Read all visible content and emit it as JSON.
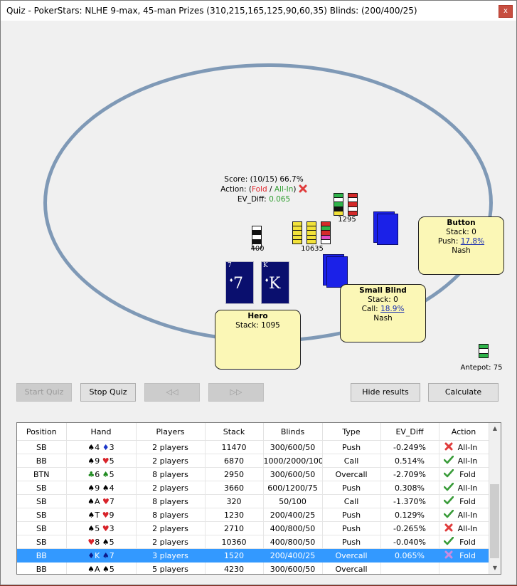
{
  "window": {
    "title": "Quiz - PokerStars: NLHE 9-max, 45-man Prizes (310,215,165,125,90,60,35) Blinds: (200/400/25)",
    "close_label": "x"
  },
  "quiz_info": {
    "score": "Score: (10/15) 66.7%",
    "action_prefix": "Action: (",
    "action_fold": "Fold",
    "action_sep": " / ",
    "action_allin": "All-In",
    "action_suffix": ")",
    "ev_prefix": "EV_Diff: ",
    "ev_value": "0.065"
  },
  "players": {
    "button": {
      "name": "Button",
      "stack": "Stack: 0",
      "push_prefix": "Push: ",
      "push_pct": "17.8%",
      "mode": "Nash"
    },
    "small_blind": {
      "name": "Small Blind",
      "stack": "Stack: 0",
      "call_prefix": "Call: ",
      "call_pct": "18.9%",
      "mode": "Nash"
    },
    "hero": {
      "name": "Hero",
      "stack": "Stack: 1095"
    }
  },
  "hero_cards": [
    {
      "rank": "7",
      "suit": "♦"
    },
    {
      "rank": "K",
      "suit": "♦"
    }
  ],
  "chips": {
    "hero_bet": "400",
    "pot": "10635",
    "sb_bet": "1295",
    "antepot": "Antepot: 75"
  },
  "colors": {
    "chip_white": "#ffffff",
    "chip_black": "#111111",
    "chip_yellow": "#f2e23a",
    "chip_green": "#2fb34a",
    "chip_red": "#d42a2a",
    "chip_pink": "#e04cc2"
  },
  "buttons": {
    "start_quiz": "Start Quiz",
    "stop_quiz": "Stop Quiz",
    "prev": "◁◁",
    "next": "▷▷",
    "hide_results": "Hide results",
    "calculate": "Calculate"
  },
  "results": {
    "columns": [
      "Position",
      "Hand",
      "Players",
      "Stack",
      "Blinds",
      "Type",
      "EV_Diff",
      "Action"
    ],
    "rows": [
      {
        "position": "SB",
        "hand": [
          [
            "♠",
            "4",
            "b"
          ],
          [
            "♦",
            "3",
            "u"
          ]
        ],
        "players": "2 players",
        "stack": "11470",
        "blinds": "300/600/50",
        "type": "Push",
        "ev": "-0.249%",
        "icon": "wrong",
        "action": "All-In"
      },
      {
        "position": "BB",
        "hand": [
          [
            "♠",
            "9",
            "b"
          ],
          [
            "♥",
            "5",
            "r"
          ]
        ],
        "players": "2 players",
        "stack": "6870",
        "blinds": "1000/2000/100",
        "type": "Call",
        "ev": "0.514%",
        "icon": "right",
        "action": "All-In"
      },
      {
        "position": "BTN",
        "hand": [
          [
            "♣",
            "6",
            "g"
          ],
          [
            "♠",
            "5",
            "g"
          ]
        ],
        "players": "8 players",
        "stack": "2950",
        "blinds": "300/600/50",
        "type": "Overcall",
        "ev": "-2.709%",
        "icon": "right",
        "action": "Fold"
      },
      {
        "position": "SB",
        "hand": [
          [
            "♠",
            "9",
            "b"
          ],
          [
            "♠",
            "4",
            "b"
          ]
        ],
        "players": "2 players",
        "stack": "3660",
        "blinds": "600/1200/75",
        "type": "Push",
        "ev": "0.308%",
        "icon": "right",
        "action": "All-In"
      },
      {
        "position": "SB",
        "hand": [
          [
            "♠",
            "A",
            "b"
          ],
          [
            "♥",
            "7",
            "r"
          ]
        ],
        "players": "8 players",
        "stack": "320",
        "blinds": "50/100",
        "type": "Call",
        "ev": "-1.370%",
        "icon": "right",
        "action": "Fold"
      },
      {
        "position": "SB",
        "hand": [
          [
            "♠",
            "T",
            "b"
          ],
          [
            "♥",
            "9",
            "r"
          ]
        ],
        "players": "8 players",
        "stack": "1230",
        "blinds": "200/400/25",
        "type": "Push",
        "ev": "0.129%",
        "icon": "right",
        "action": "All-In"
      },
      {
        "position": "SB",
        "hand": [
          [
            "♠",
            "5",
            "b"
          ],
          [
            "♥",
            "3",
            "r"
          ]
        ],
        "players": "2 players",
        "stack": "2710",
        "blinds": "400/800/50",
        "type": "Push",
        "ev": "-0.265%",
        "icon": "wrong",
        "action": "All-In"
      },
      {
        "position": "SB",
        "hand": [
          [
            "♥",
            "8",
            "r"
          ],
          [
            "♠",
            "5",
            "b"
          ]
        ],
        "players": "2 players",
        "stack": "10360",
        "blinds": "400/800/50",
        "type": "Push",
        "ev": "-0.040%",
        "icon": "right",
        "action": "Fold"
      },
      {
        "position": "BB",
        "hand": [
          [
            "♦",
            "K",
            "u"
          ],
          [
            "♠",
            "7",
            "b"
          ]
        ],
        "players": "3 players",
        "stack": "1520",
        "blinds": "200/400/25",
        "type": "Overcall",
        "ev": "0.065%",
        "icon": "wrong-purple",
        "action": "Fold",
        "selected": true
      },
      {
        "position": "BB",
        "hand": [
          [
            "♠",
            "A",
            "b"
          ],
          [
            "♠",
            "5",
            "b"
          ]
        ],
        "players": "5 players",
        "stack": "4230",
        "blinds": "300/600/50",
        "type": "Overcall",
        "ev": "",
        "icon": "",
        "action": ""
      }
    ]
  }
}
